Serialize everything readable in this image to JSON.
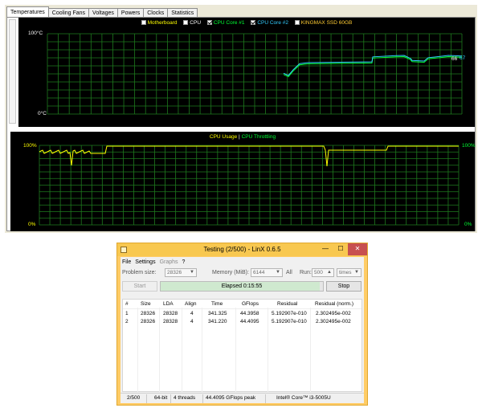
{
  "monitor": {
    "tabs": [
      "Temperatures",
      "Cooling Fans",
      "Voltages",
      "Powers",
      "Clocks",
      "Statistics"
    ],
    "active_tab": "Temperatures",
    "temp_graph": {
      "y_max_label": "100°C",
      "y_min_label": "0°C",
      "legend": [
        {
          "label": "Motherboard",
          "checked": false,
          "color": "#ffff00"
        },
        {
          "label": "CPU",
          "checked": false,
          "color": "#ffffff"
        },
        {
          "label": "CPU Core #1",
          "checked": true,
          "color": "#00ff33"
        },
        {
          "label": "CPU Core #2",
          "checked": true,
          "color": "#33ccff"
        },
        {
          "label": "KINGMAX SSD 60GB",
          "checked": false,
          "color": "#ffcc33"
        }
      ],
      "current_value_1": "66",
      "current_value_2": "67",
      "current_color_1": "#ffffff",
      "current_color_2": "#33ccff",
      "grid_color": "#1e7a1e"
    },
    "cpu_graph": {
      "legend_usage": "CPU Usage",
      "legend_separator": "|",
      "legend_throttling": "CPU Throttling",
      "usage_color": "#ffff00",
      "throttling_color": "#00ff33",
      "left_max": "100%",
      "left_min": "0%",
      "right_max": "100%",
      "right_min": "0%",
      "grid_color": "#1e7a1e"
    }
  },
  "linx": {
    "title": "Testing (2/500) - LinX 0.6.5",
    "window_buttons": {
      "minimize": "—",
      "maximize": "☐",
      "close": "✕"
    },
    "menu": [
      {
        "label": "File",
        "enabled": true
      },
      {
        "label": "Settings",
        "enabled": true
      },
      {
        "label": "Graphs",
        "enabled": false
      },
      {
        "label": "?",
        "enabled": true
      }
    ],
    "problem_size_label": "Problem size:",
    "problem_size_value": "28326",
    "memory_label": "Memory (MiB):",
    "memory_value": "6144",
    "all_label": "All",
    "run_label": "Run:",
    "run_value": "500",
    "run_unit": "times",
    "start_button": "Start",
    "stop_button": "Stop",
    "elapsed_text": "Elapsed 0:15:55",
    "progress_fraction": 0.98,
    "columns": [
      "#",
      "Size",
      "LDA",
      "Align",
      "Time",
      "GFlops",
      "Residual",
      "Residual (norm.)"
    ],
    "rows": [
      [
        "1",
        "28326",
        "28328",
        "4",
        "341.325",
        "44.3958",
        "5.192907e-010",
        "2.302495e-002"
      ],
      [
        "2",
        "28326",
        "28328",
        "4",
        "341.220",
        "44.4095",
        "5.192907e-010",
        "2.302495e-002"
      ]
    ],
    "status": [
      "2/500",
      "64-bit",
      "4 threads",
      "44.4095 GFlops peak",
      "Intel® Core™ i3-5005U"
    ]
  }
}
